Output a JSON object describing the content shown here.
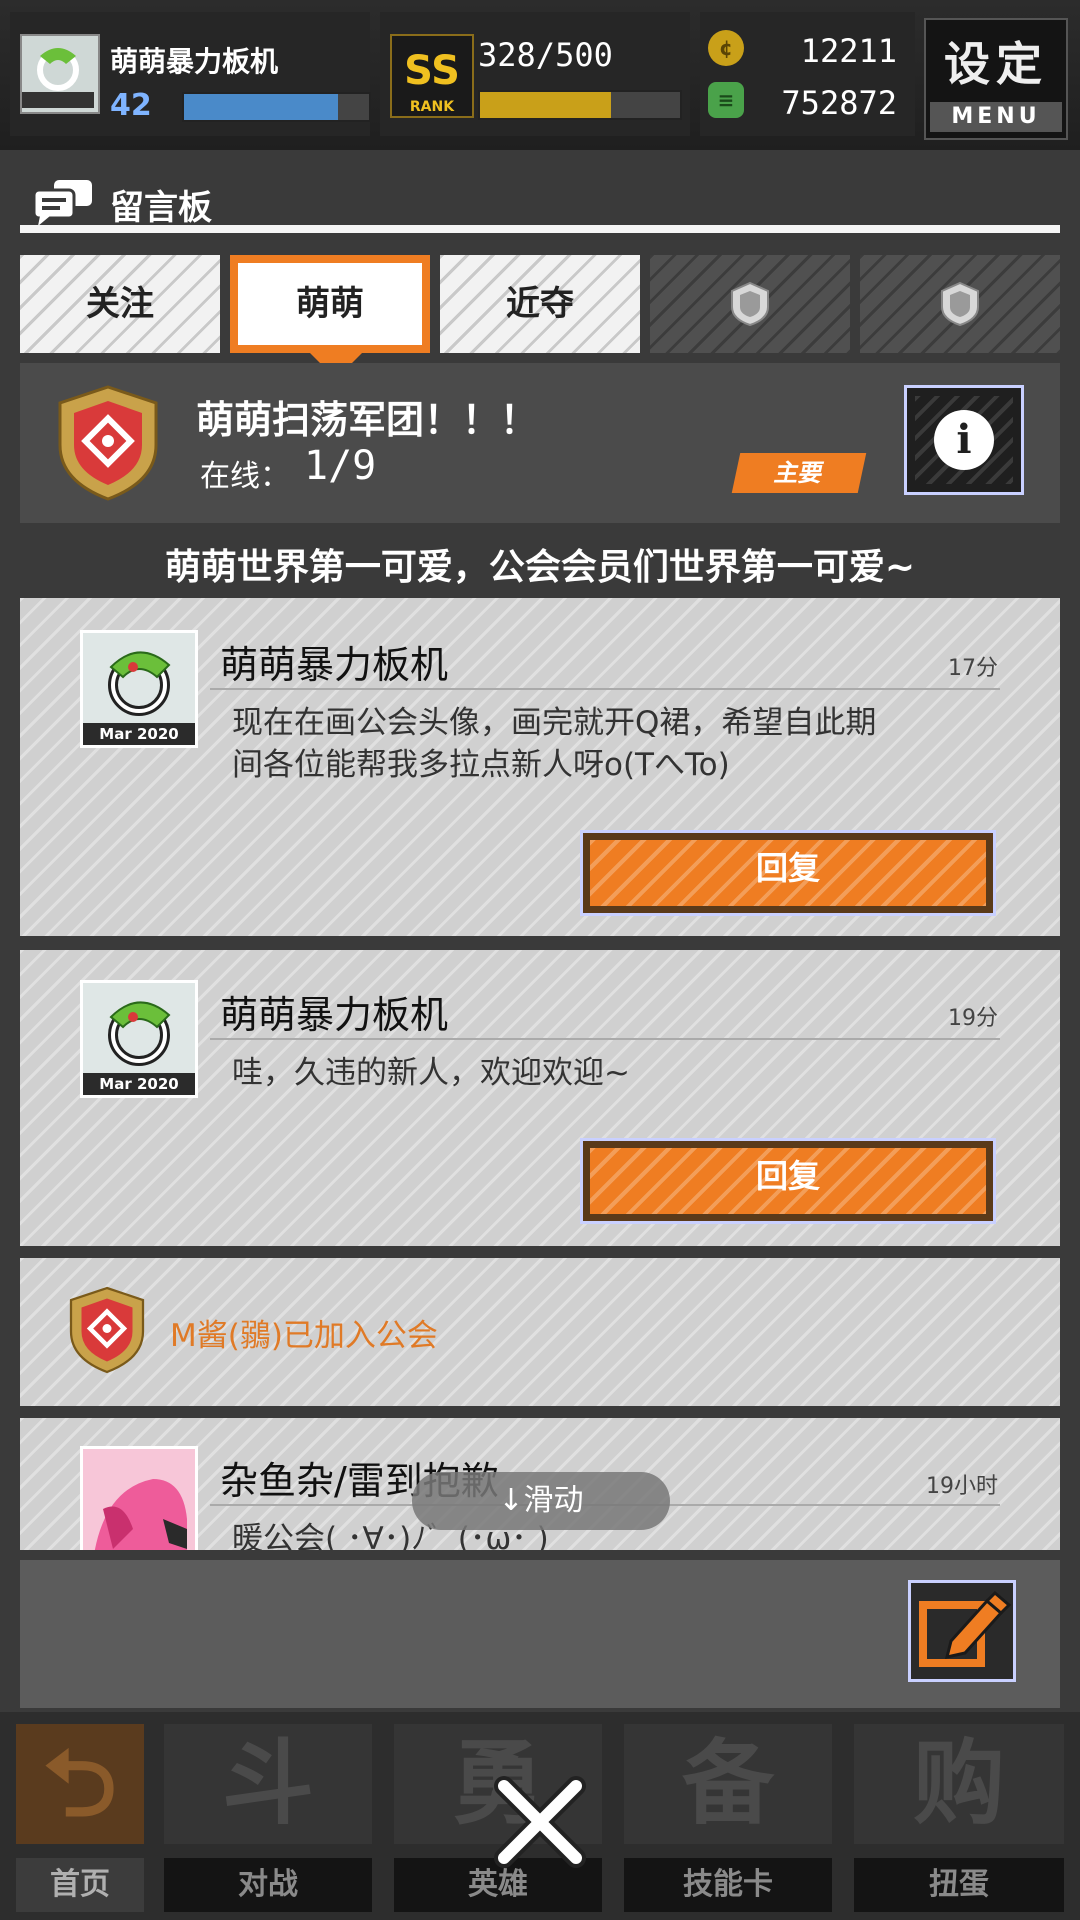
{
  "colors": {
    "accent": "#ef7d22",
    "level": "#7fb4ff",
    "gold": "#f0c020",
    "system_text": "#e07a26"
  },
  "player": {
    "name": "萌萌暴力板机",
    "level": "42",
    "exp_fraction": 0.83,
    "avatar_caption": "Mar 2020"
  },
  "rank": {
    "badge_text": "SS",
    "badge_sub": "RANK",
    "stamina": "328/500",
    "stamina_fraction": 0.656
  },
  "currency": {
    "coin_icon": "coin-icon",
    "coin_value": "12211",
    "gem_icon": "gem-stack-icon",
    "gem_value": "752872"
  },
  "menu": {
    "title": "设定",
    "subtitle": "MENU"
  },
  "panel": {
    "icon": "chat-bubbles-icon",
    "title": "留言板"
  },
  "tabs": [
    {
      "label": "关注",
      "state": "normal"
    },
    {
      "label": "萌萌",
      "state": "active"
    },
    {
      "label": "近夺",
      "state": "normal"
    },
    {
      "label": "",
      "icon": "shield-icon",
      "state": "locked"
    },
    {
      "label": "",
      "icon": "shield-icon",
      "state": "locked"
    }
  ],
  "guild": {
    "name": "萌萌扫荡军团！！！",
    "online_label": "在线：",
    "online_value": "1/9",
    "tag": "主要",
    "info_icon": "info-icon",
    "motto": "萌萌世界第一可爱，公会会员们世界第一可爱~"
  },
  "posts": [
    {
      "author": "萌萌暴力板机",
      "time": "17分",
      "text_line1": "现在在画公会头像，画完就开Q裙，希望自此期",
      "text_line2": "间各位能帮我多拉点新人呀o(TへTo)",
      "avatar_caption": "Mar 2020",
      "reply_label": "回复"
    },
    {
      "author": "萌萌暴力板机",
      "time": "19分",
      "text_line1": "哇，久违的新人，欢迎欢迎~",
      "avatar_caption": "Mar 2020",
      "reply_label": "回复"
    },
    {
      "system_text": "M酱(鶸)已加入公会"
    },
    {
      "author": "杂鱼杂/雷到抱歉",
      "time": "19小时",
      "text_line1": "暖公会( ･∀･)ﾉ゛(･ω･ )"
    }
  ],
  "scroll_hint": "↓滑动",
  "compose_icon": "edit-icon",
  "bottom_nav": [
    {
      "label": "首页",
      "glyph": "⮌"
    },
    {
      "label": "对战",
      "glyph": "斗"
    },
    {
      "label": "英雄",
      "glyph": "勇"
    },
    {
      "label": "技能卡",
      "glyph": "备"
    },
    {
      "label": "扭蛋",
      "glyph": "购"
    }
  ],
  "close_icon": "close-icon"
}
